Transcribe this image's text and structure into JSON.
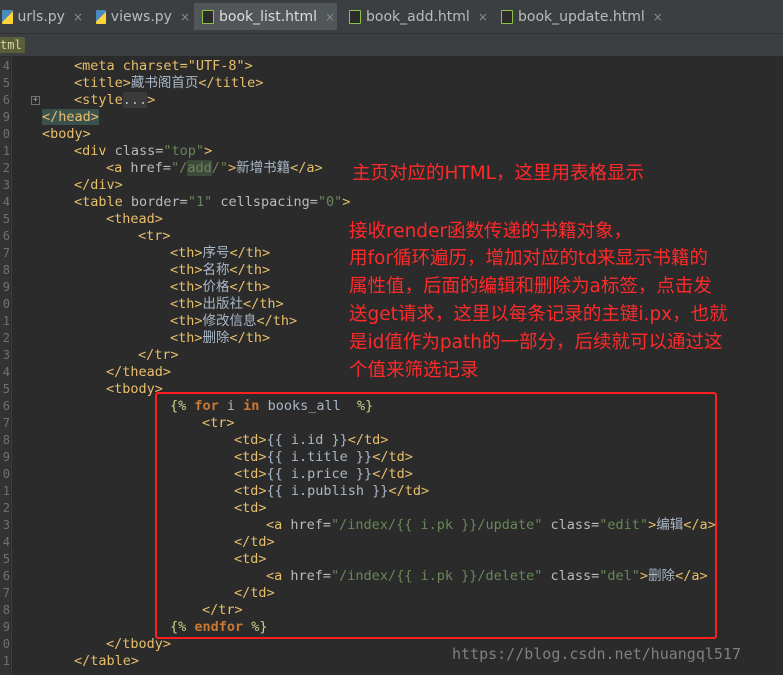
{
  "tabs": [
    {
      "label": "urls.py",
      "type": "py",
      "active": false
    },
    {
      "label": "views.py",
      "type": "py",
      "active": false
    },
    {
      "label": "book_list.html",
      "type": "html",
      "active": true
    },
    {
      "label": "book_add.html",
      "type": "html",
      "active": false
    },
    {
      "label": "book_update.html",
      "type": "html",
      "active": false
    }
  ],
  "close_glyph": "×",
  "breadcrumb": "tml",
  "line_numbers": [
    "4",
    "5",
    "6",
    "9",
    "0",
    "1",
    "2",
    "3",
    "4",
    "5",
    "6",
    "7",
    "8",
    "9",
    "0",
    "1",
    "2",
    "3",
    "4",
    "5",
    "6",
    "7",
    "8",
    "9",
    "0",
    "1",
    "2",
    "3",
    "4",
    "5",
    "6",
    "7",
    "8",
    "9",
    "0",
    "1"
  ],
  "code": {
    "meta": "<meta charset=\"UTF-8\">",
    "title_open": "<title>",
    "title_text": "藏书阁首页",
    "title_close": "</title>",
    "style_open": "<style",
    "style_fold": "...",
    "style_close": ">",
    "head_close": "</head>",
    "body_open": "<body>",
    "div_open_tag": "<div",
    "div_class_attr": " class=",
    "div_class_val": "\"top\"",
    "div_end": ">",
    "a_open": "<a",
    "a_href_attr": " href=",
    "a_href_q1": "\"/",
    "a_href_hl": "add",
    "a_href_q2": "/\"",
    "a_end": ">",
    "a_text": "新增书籍",
    "a_close": "</a>",
    "div_close": "</div>",
    "table_open": "<table",
    "table_border_attr": " border=",
    "table_border_val": "\"1\"",
    "table_cs_attr": " cellspacing=",
    "table_cs_val": "\"0\"",
    "table_end": ">",
    "thead_open": "<thead>",
    "tr_open": "<tr>",
    "th_open": "<th>",
    "th_close": "</th>",
    "th_items": [
      "序号",
      "名称",
      "价格",
      "出版社",
      "修改信息",
      "删除"
    ],
    "tr_close": "</tr>",
    "thead_close": "</thead>",
    "tbody_open": "<tbody>",
    "for_open": "{%",
    "for_kw": " for ",
    "for_var": "i",
    "for_in": " in ",
    "for_iter": "books_all",
    "for_close": "  %}",
    "td_open": "<td>",
    "td_close": "</td>",
    "td_exprs": [
      "{{ i.id }}",
      "{{ i.title }}",
      "{{ i.price }}",
      "{{ i.publish }}"
    ],
    "edit_href": "\"/index/{{ i.pk }}/update\"",
    "edit_class_attr": " class=",
    "edit_class_val": "\"edit\"",
    "edit_text": "编辑",
    "del_href": "\"/index/{{ i.pk }}/delete\"",
    "del_class_val": "\"del\"",
    "del_text": "删除",
    "endfor_open": "{%",
    "endfor_kw": " endfor ",
    "endfor_close": "%}",
    "tbody_close": "</tbody>",
    "table_close": "</table>"
  },
  "annotations": {
    "note1": "主页对应的HTML，这里用表格显示",
    "note2_lines": [
      "接收render函数传递的书籍对象，",
      "用for循环遍历，增加对应的td来显示书籍的",
      "属性值，后面的编辑和删除为a标签，点击发",
      "送get请求，这里以每条记录的主键i.px，也就",
      "是id值作为path的一部分，后续就可以通过这",
      "个值来筛选记录"
    ]
  },
  "colors": {
    "annotation": "#ff2a2a",
    "tag": "#e8bf6a",
    "string": "#6a8759",
    "keyword": "#cc7832",
    "background": "#2b2b2b"
  },
  "watermark": "https://blog.csdn.net/huangql517"
}
